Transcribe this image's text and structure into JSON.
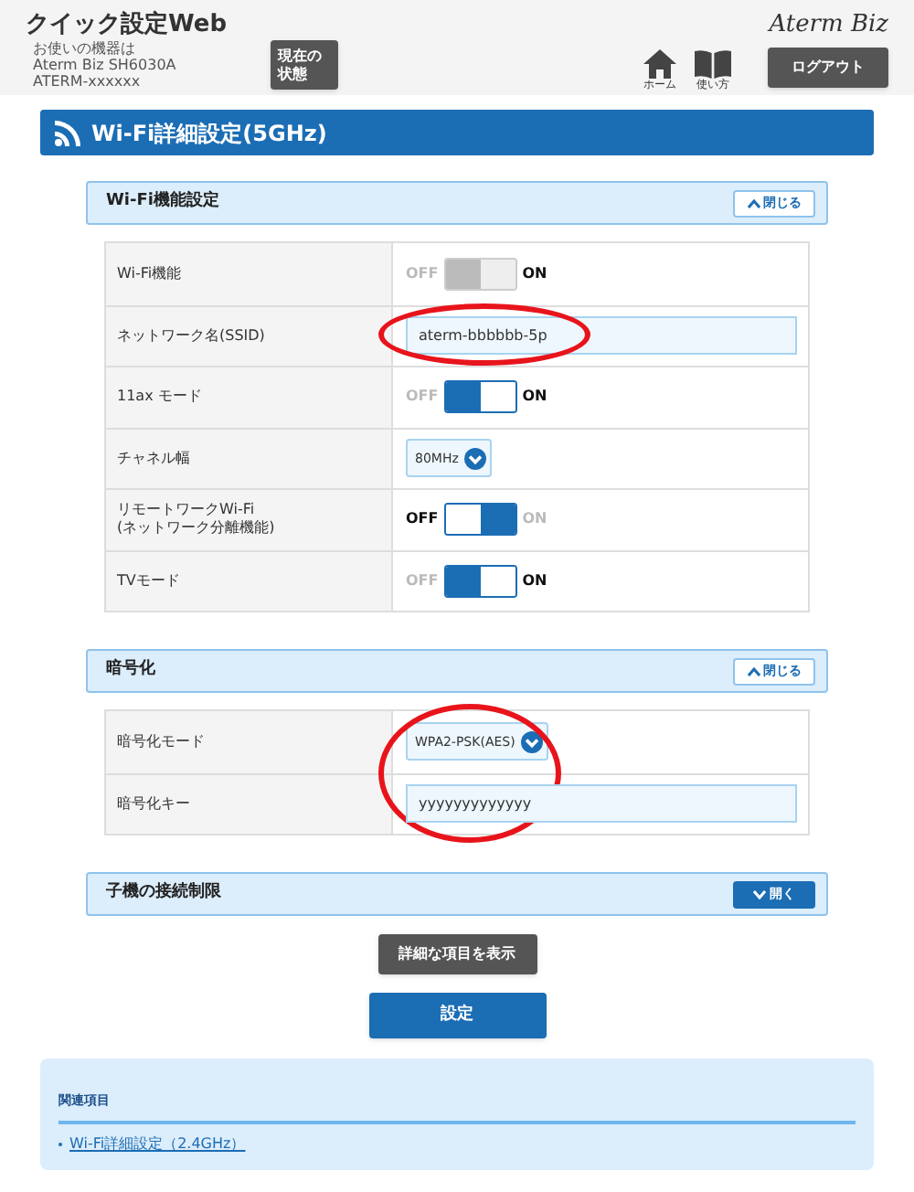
{
  "header": {
    "app_title": "クイック設定Web",
    "device_lines": [
      "お使いの機器は",
      "Aterm Biz SH6030A",
      "ATERM-xxxxxx"
    ],
    "status_button": "現在の状態",
    "home_label": "ホーム",
    "help_label": "使い方",
    "brand": "Aterm Biz",
    "logout_button": "ログアウト"
  },
  "page_title": "Wi-Fi詳細設定(5GHz)",
  "sections": [
    {
      "title": "Wi-Fi機能設定",
      "expanded": true,
      "toggle_label": "閉じる",
      "rows": [
        {
          "kind": "switch",
          "label": "Wi-Fi機能",
          "off_label": "OFF",
          "on_label": "ON",
          "on": true,
          "disabled": true
        },
        {
          "kind": "text",
          "label": "ネットワーク名(SSID)",
          "value": "aterm-bbbbbb-5p",
          "circled": true
        },
        {
          "kind": "switch",
          "label": "11ax モード",
          "off_label": "OFF",
          "on_label": "ON",
          "on": true,
          "disabled": false
        },
        {
          "kind": "select",
          "label": "チャネル幅",
          "value": "80MHz"
        },
        {
          "kind": "switch",
          "label": "リモートワークWi-Fi\n(ネットワーク分離機能)",
          "off_label": "OFF",
          "on_label": "ON",
          "on": false,
          "disabled": false
        },
        {
          "kind": "switch",
          "label": "TVモード",
          "off_label": "OFF",
          "on_label": "ON",
          "on": true,
          "disabled": false
        }
      ]
    },
    {
      "title": "暗号化",
      "expanded": true,
      "toggle_label": "閉じる",
      "rows": [
        {
          "kind": "select",
          "label": "暗号化モード",
          "value": "WPA2-PSK(AES)",
          "circled": true
        },
        {
          "kind": "text",
          "label": "暗号化キー",
          "value": "yyyyyyyyyyyyy"
        }
      ]
    },
    {
      "title": "子機の接続制限",
      "expanded": false,
      "toggle_label": "開く"
    }
  ],
  "details_button": "詳細な項目を表示",
  "submit_button": "設定",
  "related": {
    "title": "関連項目",
    "links": [
      "Wi-Fi詳細設定（2.4GHz）"
    ]
  }
}
